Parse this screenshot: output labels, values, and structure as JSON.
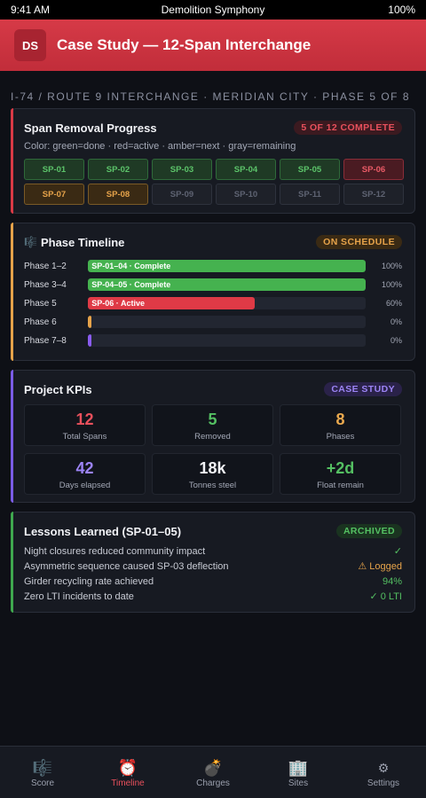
{
  "status_bar": {
    "time": "9:41 AM",
    "app_name": "Demolition Symphony",
    "battery": "100%"
  },
  "header": {
    "logo": "DS",
    "title": "Case Study — 12-Span Interchange"
  },
  "breadcrumb": "I-74 / ROUTE 9 INTERCHANGE · MERIDIAN CITY · PHASE 5 OF 8",
  "span_progress": {
    "title": "Span Removal Progress",
    "badge": "5 OF 12 COMPLETE",
    "legend": "Color: green=done · red=active · amber=next · gray=remaining",
    "spans": [
      {
        "label": "SP-01",
        "state": "done"
      },
      {
        "label": "SP-02",
        "state": "done"
      },
      {
        "label": "SP-03",
        "state": "done"
      },
      {
        "label": "SP-04",
        "state": "done"
      },
      {
        "label": "SP-05",
        "state": "done"
      },
      {
        "label": "SP-06",
        "state": "active"
      },
      {
        "label": "SP-07",
        "state": "next"
      },
      {
        "label": "SP-08",
        "state": "next"
      },
      {
        "label": "SP-09",
        "state": "remaining"
      },
      {
        "label": "SP-10",
        "state": "remaining"
      },
      {
        "label": "SP-11",
        "state": "remaining"
      },
      {
        "label": "SP-12",
        "state": "remaining"
      }
    ]
  },
  "timeline": {
    "icon": "score-icon",
    "title": "Phase Timeline",
    "badge": "ON SCHEDULE",
    "phases": [
      {
        "label": "Phase 1–2",
        "bar_text": "SP-01–04 · Complete",
        "progress": 1.0,
        "pct": "100%",
        "color": "#45b24f"
      },
      {
        "label": "Phase 3–4",
        "bar_text": "SP-04–05 · Complete",
        "progress": 1.0,
        "pct": "100%",
        "color": "#45b24f"
      },
      {
        "label": "Phase 5",
        "bar_text": "SP-06 · Active",
        "progress": 0.6,
        "pct": "60%",
        "color": "#df3a46"
      },
      {
        "label": "Phase 6",
        "bar_text": "",
        "progress": 0.0,
        "pct": "0%",
        "color": "#e6a34a"
      },
      {
        "label": "Phase 7–8",
        "bar_text": "",
        "progress": 0.0,
        "pct": "0%",
        "color": "#8a5cf0"
      }
    ]
  },
  "kpis": {
    "title": "Project KPIs",
    "badge": "CASE STUDY",
    "items": [
      {
        "value": "12",
        "label": "Total Spans",
        "color": "#e8505c"
      },
      {
        "value": "5",
        "label": "Removed",
        "color": "#54c062"
      },
      {
        "value": "8",
        "label": "Phases",
        "color": "#eaa94e"
      },
      {
        "value": "42",
        "label": "Days elapsed",
        "color": "#9c84f5"
      },
      {
        "value": "18k",
        "label": "Tonnes steel",
        "color": "#f1f2f6"
      },
      {
        "value": "+2d",
        "label": "Float remain",
        "color": "#54c062"
      }
    ]
  },
  "lessons": {
    "title": "Lessons Learned (SP-01–05)",
    "badge": "ARCHIVED",
    "items": [
      {
        "text": "Night closures reduced community impact",
        "status": "✓",
        "color": "#54c062"
      },
      {
        "text": "Asymmetric sequence caused SP-03 deflection",
        "status": "⚠ Logged",
        "color": "#e6a34a"
      },
      {
        "text": "Girder recycling rate achieved",
        "status": "94%",
        "color": "#54c062"
      },
      {
        "text": "Zero LTI incidents to date",
        "status": "✓ 0 LTI",
        "color": "#54c062"
      }
    ]
  },
  "tabs": [
    {
      "label": "Score",
      "icon": "🎼",
      "icon_name": "score-icon",
      "active": false
    },
    {
      "label": "Timeline",
      "icon": "⏰",
      "icon_name": "alarm-clock-icon",
      "active": true
    },
    {
      "label": "Charges",
      "icon": "💣",
      "icon_name": "bomb-icon",
      "active": false
    },
    {
      "label": "Sites",
      "icon": "🏢",
      "icon_name": "building-icon",
      "active": false
    },
    {
      "label": "Settings",
      "icon": "⚙",
      "icon_name": "gear-icon",
      "active": false
    }
  ]
}
